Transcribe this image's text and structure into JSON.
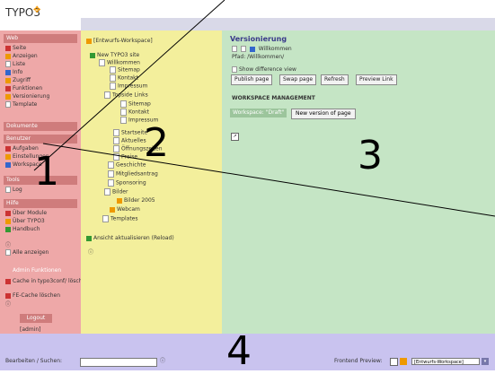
{
  "app": {
    "logo_text": "TYPO3"
  },
  "labels": {
    "n1": "1",
    "n2": "2",
    "n3": "3",
    "n4": "4"
  },
  "left_menu": {
    "web_header": "Web",
    "web_items": [
      "Seite",
      "Anzeigen",
      "Liste",
      "Info",
      "Zugriff",
      "Funktionen",
      "Versionierung",
      "Template"
    ],
    "dokumente_header": "Dokumente",
    "benutzer_header": "Benutzer",
    "benutzer_items": [
      "Aufgaben",
      "Einstellungen",
      "Workspace"
    ],
    "tools_header": "Tools",
    "tools_items": [
      "Log"
    ],
    "hilfe_header": "Hilfe",
    "hilfe_items": [
      "Über Module",
      "Über TYPO3",
      "Handbuch"
    ],
    "show_all": "Alle anzeigen",
    "admin_header": "Admin Funktionen",
    "admin_items": [
      "Cache in typo3conf/ löschen",
      "FE-Cache löschen"
    ],
    "logout": "Logout",
    "user": "[admin]"
  },
  "tree": {
    "workspace": "[Entwurfs-Workspace]",
    "root": "New TYPO3 site",
    "items": [
      "Willkommen",
      "Sitemap",
      "Kontakt",
      "Impressum",
      "Topside Links",
      "Sitemap",
      "Kontakt",
      "Impressum",
      "Startseite",
      "Aktuelles",
      "Öffnungszeiten",
      "Preise",
      "Geschichte",
      "Mitgliedsantrag",
      "Sponsoring",
      "Bilder",
      "Bilder 2005",
      "Webcam",
      "Templates"
    ],
    "reload": "Ansicht aktualisieren (Reload)"
  },
  "content": {
    "title": "Versionierung",
    "page_name": "Willkommen",
    "path": "Pfad: /Willkommen/",
    "show_diff": "Show difference view",
    "buttons": [
      "Publish page",
      "Swap page",
      "Refresh",
      "Preview Link"
    ],
    "ws_mgmt": "WORKSPACE MANAGEMENT",
    "ws_tag": "Workspace: \"Draft\"",
    "new_version": "New version of page"
  },
  "bottom": {
    "search_label": "Bearbeiten / Suchen:",
    "preview_label": "Frontend Preview:",
    "workspace_select": "[Entwurfs-Workspace]"
  }
}
